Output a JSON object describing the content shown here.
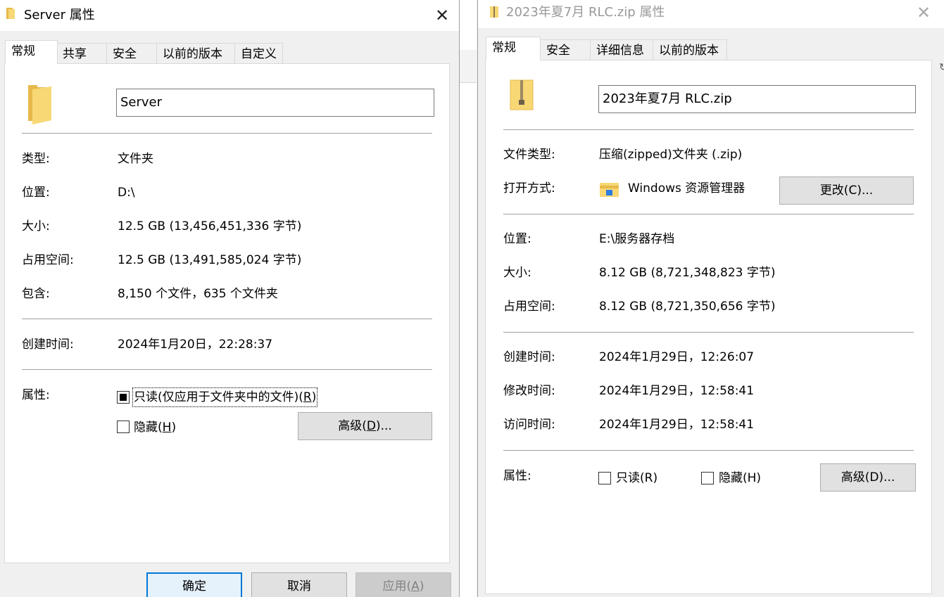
{
  "win1": {
    "title": "Server 属性",
    "close_glyph": "✕",
    "tabs": [
      "常规",
      "共享",
      "安全",
      "以前的版本",
      "自定义"
    ],
    "name_value": "Server",
    "rows": [
      {
        "label": "类型:",
        "value": "文件夹"
      },
      {
        "label": "位置:",
        "value": "D:\\"
      },
      {
        "label": "大小:",
        "value": "12.5 GB (13,456,451,336 字节)"
      },
      {
        "label": "占用空间:",
        "value": "12.5 GB (13,491,585,024 字节)"
      },
      {
        "label": "包含:",
        "value": "8,150 个文件，635 个文件夹"
      }
    ],
    "created_label": "创建时间:",
    "created_value": "2024年1月20日，22:28:37",
    "attr_label": "属性:",
    "readonly": {
      "text": "只读(仅应用于文件夹中的文件)(",
      "key": "R",
      "close": ")",
      "state": "indeterminate"
    },
    "hidden": {
      "text": "隐藏(",
      "key": "H",
      "close": ")",
      "checked": false
    },
    "advanced": {
      "text": "高级(",
      "key": "D",
      "close": ")..."
    },
    "ok_label": "确定",
    "cancel_label": "取消",
    "apply": {
      "text": "应用(",
      "key": "A",
      "close": ")"
    }
  },
  "win2": {
    "title": "2023年夏7月 RLC.zip 属性",
    "close_glyph": "✕",
    "tabs": [
      "常规",
      "安全",
      "详细信息",
      "以前的版本"
    ],
    "name_value": "2023年夏7月 RLC.zip",
    "file_type_label": "文件类型:",
    "file_type_value": "压缩(zipped)文件夹 (.zip)",
    "open_with_label": "打开方式:",
    "open_with_value": "Windows 资源管理器",
    "change_button": "更改(C)...",
    "rows": [
      {
        "label": "位置:",
        "value": "E:\\服务器存档"
      },
      {
        "label": "大小:",
        "value": "8.12 GB (8,721,348,823 字节)"
      },
      {
        "label": "占用空间:",
        "value": "8.12 GB (8,721,350,656 字节)"
      }
    ],
    "times": [
      {
        "label": "创建时间:",
        "value": "2024年1月29日，12:26:07"
      },
      {
        "label": "修改时间:",
        "value": "2024年1月29日，12:58:41"
      },
      {
        "label": "访问时间:",
        "value": "2024年1月29日，12:58:41"
      }
    ],
    "attr_label": "属性:",
    "readonly_label": "只读(R)",
    "hidden_label": "隐藏(H)",
    "advanced_button": "高级(D)..."
  },
  "icons": {
    "folder": "folder-icon",
    "zip": "zip-folder-icon",
    "explorer": "file-explorer-icon",
    "close": "close-icon"
  },
  "colors": {
    "folder_yellow": "#f8d775",
    "accent_blue": "#0078d7",
    "panel_bg": "#ffffff",
    "window_bg": "#f0f0f0"
  }
}
